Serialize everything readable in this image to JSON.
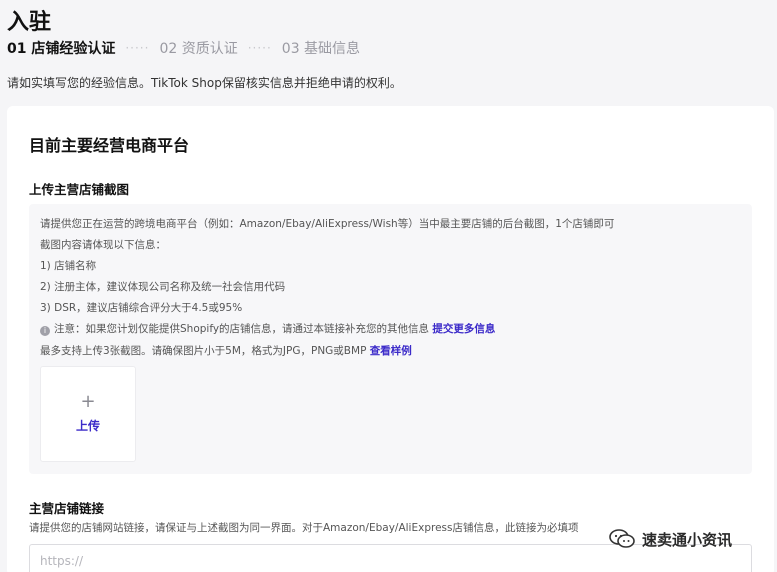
{
  "page": {
    "title": "入驻",
    "steps": [
      {
        "label": "01 店铺经验认证",
        "active": true
      },
      {
        "label": "02 资质认证",
        "active": false
      },
      {
        "label": "03 基础信息",
        "active": false
      }
    ],
    "step_separator": "·····",
    "intro": "请如实填写您的经验信息。TikTok Shop保留核实信息并拒绝申请的权利。"
  },
  "card": {
    "title": "目前主要经营电商平台",
    "upload_section": {
      "label": "上传主营店铺截图",
      "guide_lines": [
        "请提供您正在运营的跨境电商平台（例如：Amazon/Ebay/AliExpress/Wish等）当中最主要店铺的后台截图，1个店铺即可",
        "截图内容请体现以下信息：",
        "1) 店铺名称",
        "2) 注册主体，建议体现公司名称及统一社会信用代码",
        "3) DSR，建议店铺综合评分大于4.5或95%"
      ],
      "notice_icon": "info-icon",
      "notice_text": "注意：如果您计划仅能提供Shopify的店铺信息，请通过本链接补充您的其他信息",
      "notice_link": "提交更多信息",
      "limit_text": "最多支持上传3张截图。请确保图片小于5M，格式为JPG，PNG或BMP",
      "limit_link": "查看样例",
      "upload_plus": "+",
      "upload_label": "上传"
    },
    "link_section": {
      "label": "主营店铺链接",
      "hint": "请提供您的店铺网站链接，请保证与上述截图为同一界面。对于Amazon/Ebay/AliExpress店铺信息，此链接为必填项",
      "input_value": "",
      "input_placeholder": "https://"
    }
  },
  "watermark": {
    "text": "速卖通小资讯",
    "icon": "wechat-icon"
  },
  "colors": {
    "accent": "#3c2bc9",
    "background": "#f5f5f7",
    "panel": "#f7f7f9"
  }
}
